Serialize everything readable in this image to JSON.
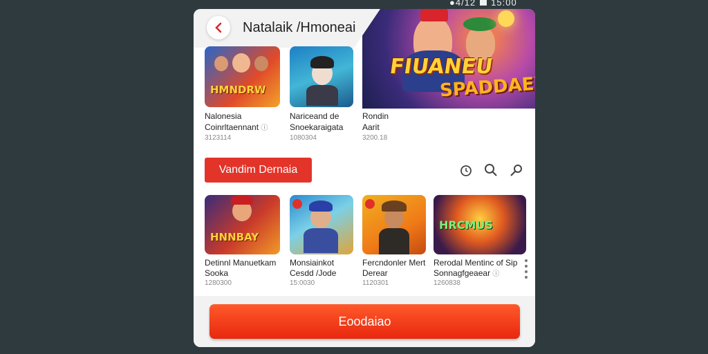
{
  "status_bar": {
    "text": "●4/12",
    "time": "15:00"
  },
  "header": {
    "title": "Natalaik /Hmoneai"
  },
  "hero": {
    "title": "FIUANEU",
    "subtitle": "SPADDAEX"
  },
  "top_games": [
    {
      "art": "HMNDRW",
      "name": "Nalonesia",
      "subtitle": "Coinrltaennant",
      "meta": "3123114"
    },
    {
      "art": "",
      "name": "Nariceand de",
      "subtitle": "Snoekaraigata",
      "meta": "1080304"
    },
    {
      "art": "",
      "name": "Rondin",
      "subtitle": "Aarit",
      "meta": "3200.18"
    }
  ],
  "section": {
    "button_label": "Vandim Dernaia"
  },
  "bottom_games": [
    {
      "art": "HNNBAY",
      "name": "Detinnl Manuetkam",
      "subtitle": "Sooka",
      "meta": "1280300"
    },
    {
      "art": "",
      "name": "Monsiainkot",
      "subtitle": "Cesdd /Jode",
      "meta": "15:0030"
    },
    {
      "art": "",
      "name": "Fercndonler Mert",
      "subtitle": "Derear",
      "meta": "1120301"
    },
    {
      "art": "HRCMUS",
      "name": "Rerodal Mentinc of Sip",
      "subtitle": "Sonnagfgeaear",
      "meta": "1260838"
    }
  ],
  "footer": {
    "cta_label": "Eoodaiao"
  },
  "colors": {
    "accent": "#e3342a",
    "cta": "#f03c16",
    "background": "#2f3a3e"
  }
}
